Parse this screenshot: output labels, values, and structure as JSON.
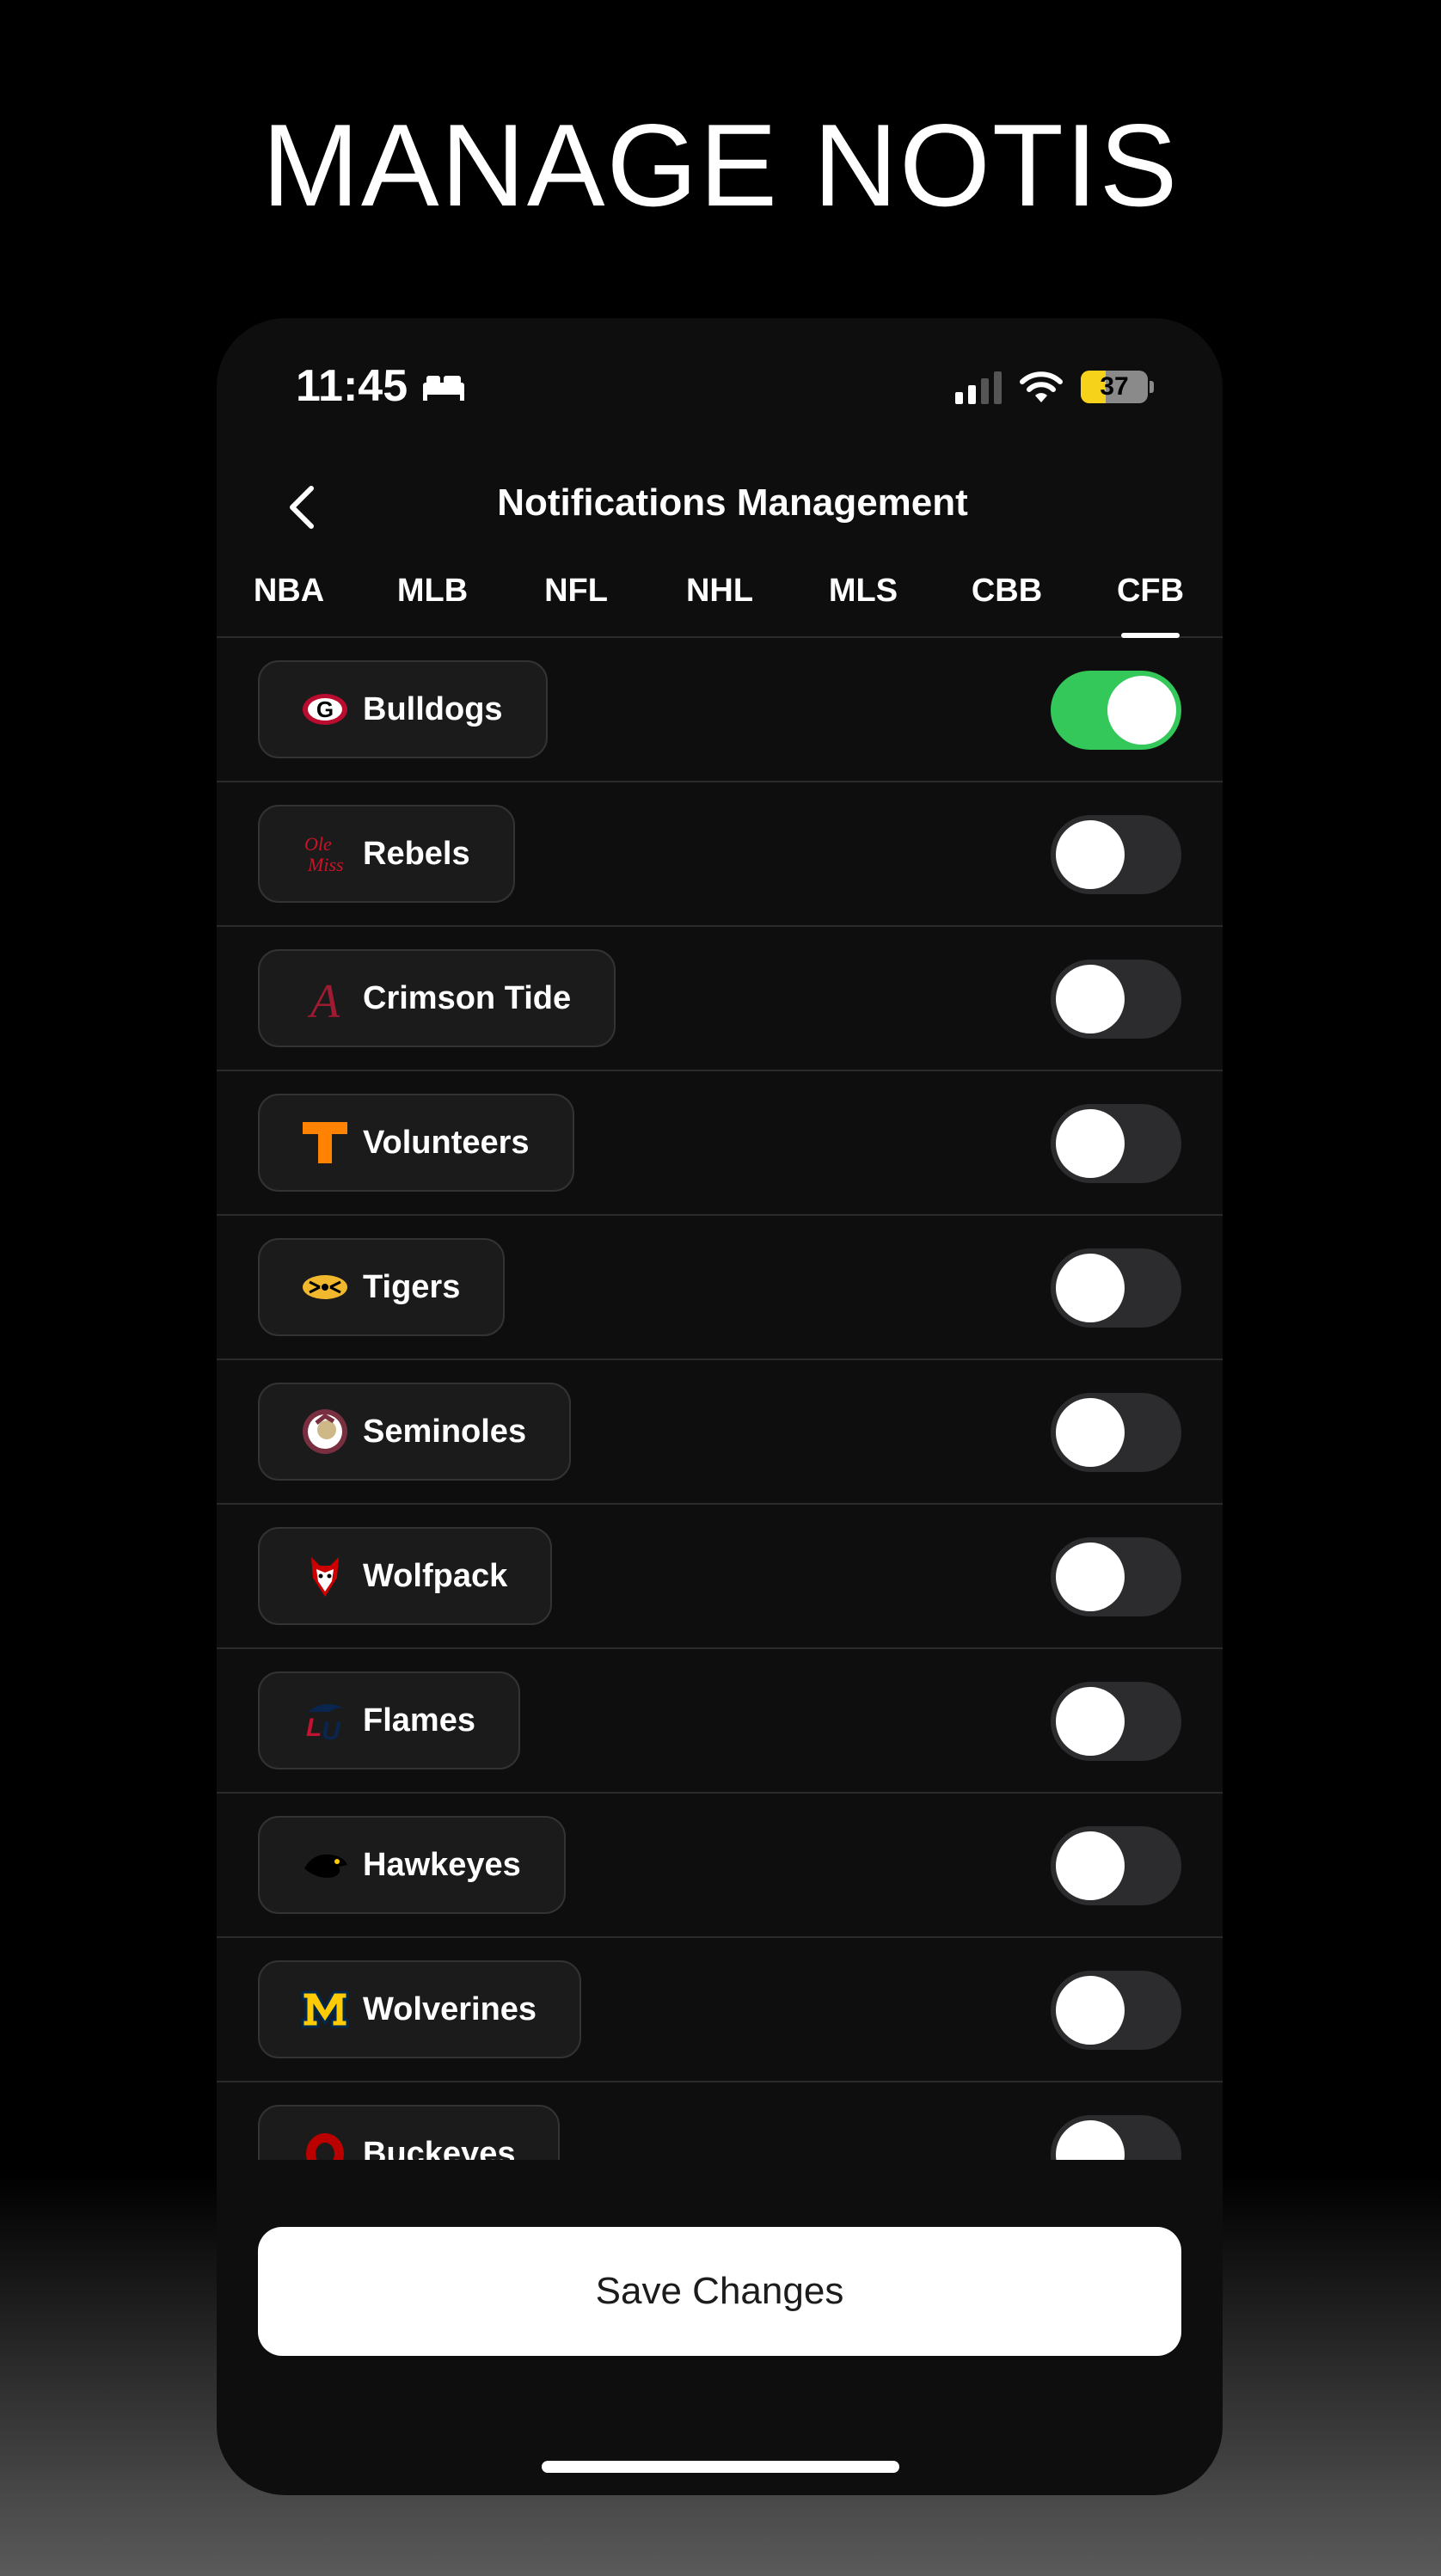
{
  "headline": "MANAGE NOTIS",
  "status_bar": {
    "time": "11:45",
    "battery": "37"
  },
  "header": {
    "title": "Notifications Management"
  },
  "tabs": [
    {
      "label": "NBA"
    },
    {
      "label": "MLB"
    },
    {
      "label": "NFL"
    },
    {
      "label": "NHL"
    },
    {
      "label": "MLS"
    },
    {
      "label": "CBB"
    },
    {
      "label": "CFB",
      "active": true
    }
  ],
  "teams": [
    {
      "name": "Bulldogs",
      "enabled": true
    },
    {
      "name": "Rebels",
      "enabled": false
    },
    {
      "name": "Crimson Tide",
      "enabled": false
    },
    {
      "name": "Volunteers",
      "enabled": false
    },
    {
      "name": "Tigers",
      "enabled": false
    },
    {
      "name": "Seminoles",
      "enabled": false
    },
    {
      "name": "Wolfpack",
      "enabled": false
    },
    {
      "name": "Flames",
      "enabled": false
    },
    {
      "name": "Hawkeyes",
      "enabled": false
    },
    {
      "name": "Wolverines",
      "enabled": false
    },
    {
      "name": "Buckeyes",
      "enabled": false
    }
  ],
  "footer": {
    "save_label": "Save Changes"
  },
  "colors": {
    "toggle_on": "#34c759",
    "toggle_off": "#2c2c2f",
    "background": "#0e0e0f"
  }
}
